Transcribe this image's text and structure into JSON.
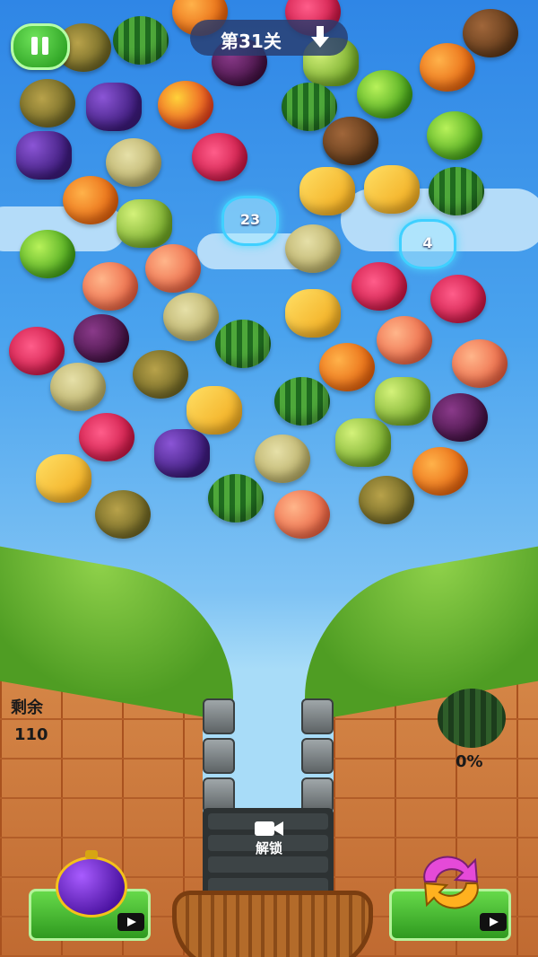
{
  "hud": {
    "level_title": "第31关",
    "pause_icon": "pause-icon",
    "drop_icon": "down-arrow-icon"
  },
  "board": {
    "fruits": [
      {
        "kind": "dragonfruit"
      },
      {
        "kind": "orange"
      },
      {
        "kind": "kiwi"
      },
      {
        "kind": "durian"
      },
      {
        "kind": "watermelon"
      },
      {
        "kind": "mangosteen"
      },
      {
        "kind": "green-grape"
      },
      {
        "kind": "orange"
      },
      {
        "kind": "kiwi"
      },
      {
        "kind": "durian"
      },
      {
        "kind": "grape"
      },
      {
        "kind": "mango"
      },
      {
        "kind": "watermelon"
      },
      {
        "kind": "lime"
      },
      {
        "kind": "grape"
      },
      {
        "kind": "melon"
      },
      {
        "kind": "dragonfruit"
      },
      {
        "kind": "kiwi"
      },
      {
        "kind": "lime"
      },
      {
        "kind": "orange"
      },
      {
        "kind": "green-grape"
      },
      {
        "kind": "carambola"
      },
      {
        "kind": "carambola"
      },
      {
        "kind": "watermelon"
      },
      {
        "kind": "lime"
      },
      {
        "kind": "melon"
      },
      {
        "kind": "peach"
      },
      {
        "kind": "peach"
      },
      {
        "kind": "dragonfruit"
      },
      {
        "kind": "dragonfruit"
      },
      {
        "kind": "dragonfruit"
      },
      {
        "kind": "mangosteen"
      },
      {
        "kind": "melon"
      },
      {
        "kind": "watermelon"
      },
      {
        "kind": "carambola"
      },
      {
        "kind": "peach"
      },
      {
        "kind": "melon"
      },
      {
        "kind": "durian"
      },
      {
        "kind": "orange"
      },
      {
        "kind": "peach"
      },
      {
        "kind": "carambola"
      },
      {
        "kind": "watermelon"
      },
      {
        "kind": "green-grape"
      },
      {
        "kind": "dragonfruit"
      },
      {
        "kind": "grape"
      },
      {
        "kind": "melon"
      },
      {
        "kind": "green-grape"
      },
      {
        "kind": "mangosteen"
      },
      {
        "kind": "carambola"
      },
      {
        "kind": "watermelon"
      },
      {
        "kind": "peach"
      },
      {
        "kind": "durian"
      },
      {
        "kind": "orange"
      },
      {
        "kind": "durian"
      }
    ],
    "ice_cells": [
      {
        "value": "23"
      },
      {
        "value": "4"
      }
    ]
  },
  "status": {
    "remaining_label": "剩余",
    "remaining_value": "110",
    "progress_percent": "0%"
  },
  "launcher": {
    "unlock_label": "解锁",
    "unlock_icon": "video-camera-icon"
  },
  "tools": {
    "bomb_icon": "bomb-icon",
    "swap_icon": "swap-arrows-icon",
    "video_icon": "video-camera-icon"
  }
}
